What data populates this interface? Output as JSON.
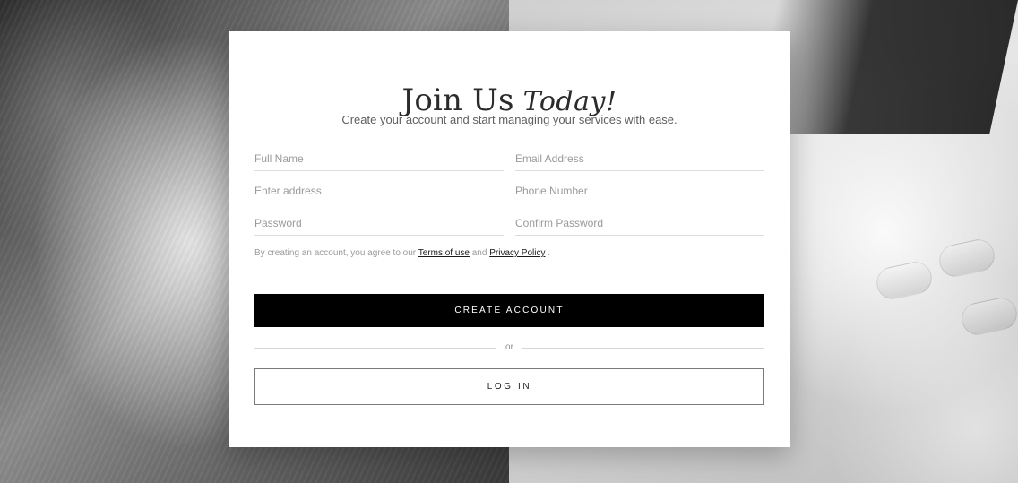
{
  "hero": {
    "title_main": "Join Us",
    "title_script": "Today!",
    "subtitle": "Create your account and start managing your services with ease."
  },
  "form": {
    "full_name_placeholder": "Full Name",
    "email_placeholder": "Email Address",
    "address_placeholder": "Enter address",
    "phone_placeholder": "Phone Number",
    "password_placeholder": "Password",
    "confirm_password_placeholder": "Confirm Password"
  },
  "legal": {
    "prefix": "By creating an account, you agree to our ",
    "terms_link": "Terms of use",
    "middle": " and ",
    "privacy_link": "Privacy Policy",
    "suffix": " ."
  },
  "actions": {
    "create_account": "CREATE ACCOUNT",
    "or": "or",
    "login": "LOG IN"
  },
  "colors": {
    "card_bg": "#ffffff",
    "primary": "#000000",
    "text_muted": "#9a9a9a",
    "border": "#dddddd"
  }
}
